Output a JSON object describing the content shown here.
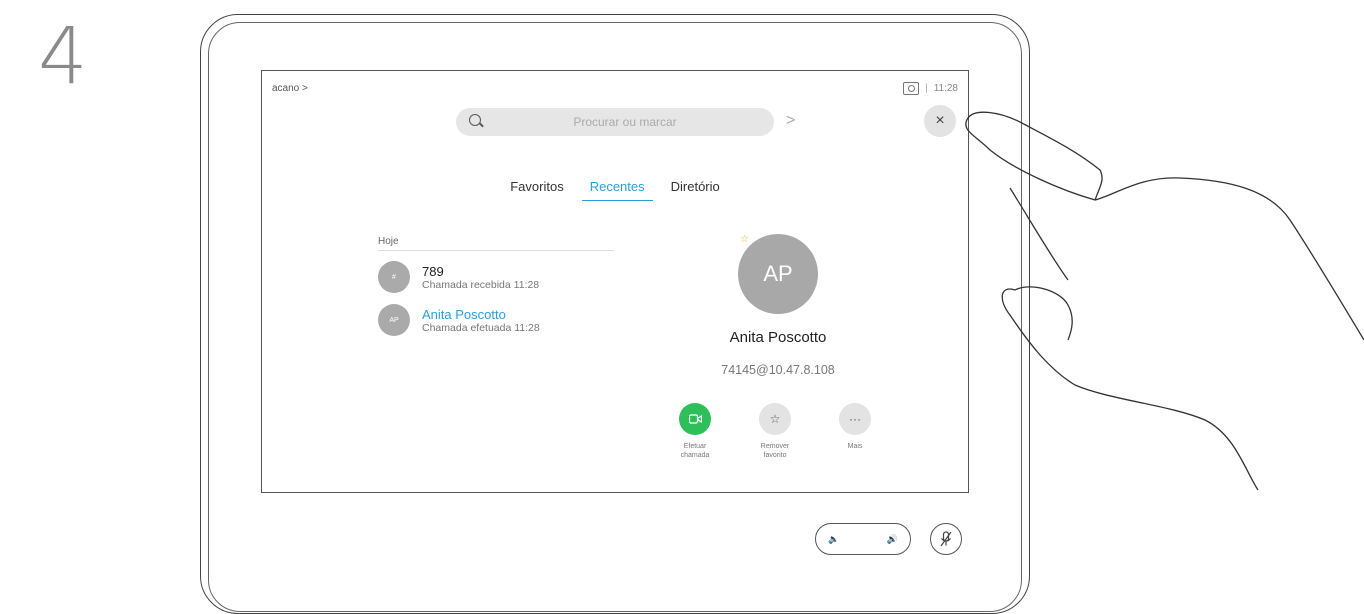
{
  "step_number": "4",
  "header": {
    "breadcrumb": "acano >",
    "time": "11:28",
    "separator": "|"
  },
  "search": {
    "placeholder": "Procurar ou marcar",
    "go": ">"
  },
  "close_glyph": "×",
  "tabs": [
    {
      "label": "Favoritos",
      "active": false
    },
    {
      "label": "Recentes",
      "active": true
    },
    {
      "label": "Diretório",
      "active": false
    }
  ],
  "recent_list": {
    "section": "Hoje",
    "items": [
      {
        "initials": "#",
        "name": "789",
        "detail": "Chamada recebida 11:28",
        "highlight": false
      },
      {
        "initials": "AP",
        "name": "Anita Poscotto",
        "detail": "Chamada efetuada 11:28",
        "highlight": true
      }
    ]
  },
  "contact": {
    "initials": "AP",
    "favorite_icon": "star-icon",
    "name": "Anita Poscotto",
    "address": "74145@10.47.8.108",
    "actions": [
      {
        "icon": "video-camera-icon",
        "label_line1": "Efetuar",
        "label_line2": "chamada",
        "color": "#2fbf5a"
      },
      {
        "icon": "star-outline-icon",
        "label_line1": "Remover",
        "label_line2": "favorito",
        "color": "#e3e3e3"
      },
      {
        "icon": "more-icon",
        "label_line1": "Mais",
        "label_line2": "",
        "color": "#e3e3e3"
      }
    ]
  },
  "controls": {
    "volume_icon": "speaker-icon",
    "mute_icon": "mic-mute-icon"
  },
  "colors": {
    "accent": "#2aa0d8",
    "call_green": "#2fbf5a"
  }
}
